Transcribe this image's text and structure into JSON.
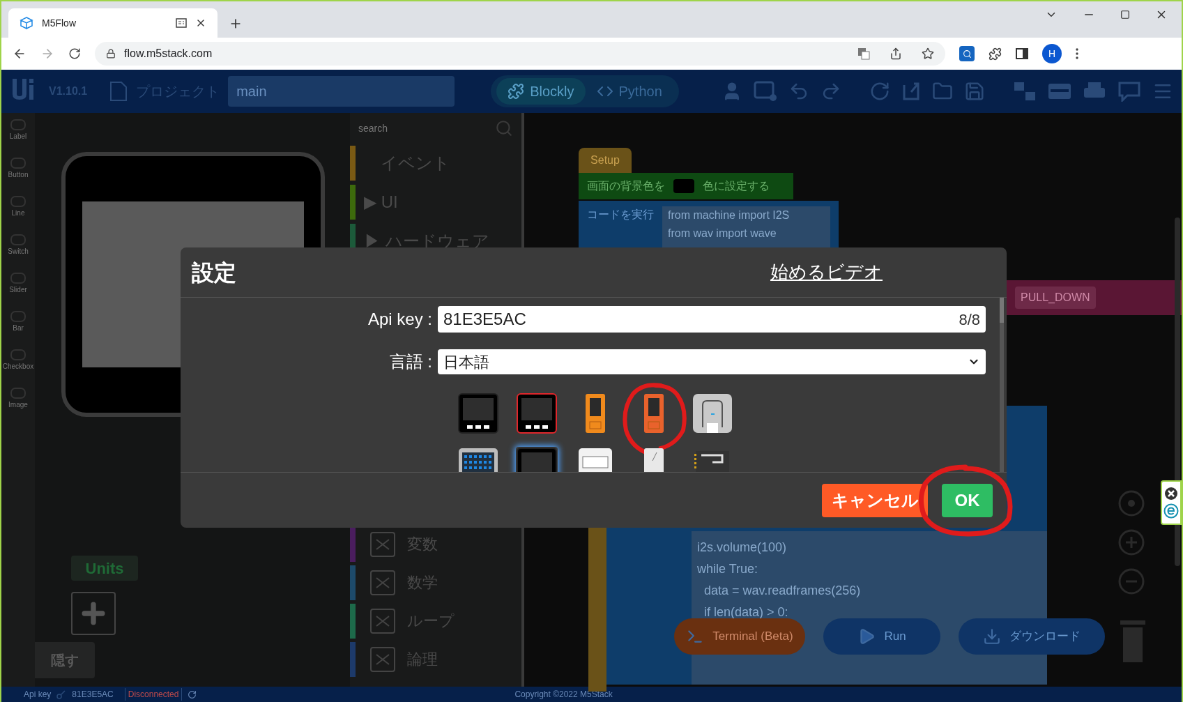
{
  "browser": {
    "tab_title": "M5Flow",
    "url": "flow.m5stack.com",
    "profile_initial": "H"
  },
  "app_header": {
    "version": "V1.10.1",
    "project_label": "プロジェクト",
    "project_name": "main",
    "modes": [
      {
        "label": "Blockly",
        "selected": true
      },
      {
        "label": "Python",
        "selected": false
      }
    ]
  },
  "ui_palette": [
    "Label",
    "Button",
    "Line",
    "Switch",
    "Slider",
    "Bar",
    "Checkbox",
    "Image"
  ],
  "units": {
    "title": "Units"
  },
  "hide_button": "隠す",
  "block_categories": {
    "search_placeholder": "search",
    "top": [
      {
        "label": "イベント",
        "color": "#7a5a14"
      },
      {
        "label": "UI",
        "marker": "▶",
        "color": "#3d6a0c"
      },
      {
        "label": "ハードウェア",
        "marker": "▶",
        "color": "#1c5a3a"
      }
    ],
    "bottom": [
      {
        "label": "変数",
        "color": "#4a1d5e"
      },
      {
        "label": "数学",
        "color": "#1d4a6a"
      },
      {
        "label": "ループ",
        "color": "#1d6a4a"
      },
      {
        "label": "論理",
        "color": "#1d3a6a"
      }
    ]
  },
  "workspace": {
    "setup": "Setup",
    "bg_block": [
      "画面の背景色を",
      "色に設定する"
    ],
    "exec_label": "コードを実行",
    "exec_code": [
      "from machine import I2S",
      "from wav import wave"
    ],
    "pin_option": "PULL_DOWN",
    "code_lines": [
      "i2s.volume(100)",
      "while True:",
      "  data = wav.readframes(256)",
      "  if len(data) > 0:"
    ],
    "actions": [
      {
        "kind": "terminal",
        "label": "Terminal (Beta)"
      },
      {
        "kind": "run",
        "label": "Run"
      },
      {
        "kind": "download",
        "label": "ダウンロード"
      }
    ]
  },
  "status_bar": {
    "api_label": "Api key",
    "api_value": "81E3E5AC",
    "connection": "Disconnected",
    "copyright": "Copyright ©2022 M5Stack"
  },
  "dialog": {
    "title": "設定",
    "video_link": "始めるビデオ",
    "api_key": {
      "label": "Api key :",
      "value": "81E3E5AC",
      "counter": "8/8"
    },
    "language": {
      "label": "言語 :",
      "value": "日本語"
    },
    "devices": [
      {
        "kind": "core-black",
        "selected": false
      },
      {
        "kind": "core-red",
        "selected": false
      },
      {
        "kind": "stick-orange",
        "selected": false
      },
      {
        "kind": "stick-dark-orange",
        "selected": false,
        "annotated": true
      },
      {
        "kind": "atom-gray",
        "selected": false
      },
      {
        "kind": "panel-blue",
        "selected": false
      },
      {
        "kind": "core-black",
        "selected": true
      },
      {
        "kind": "module-white",
        "selected": false
      },
      {
        "kind": "stick-white",
        "selected": false
      },
      {
        "kind": "board",
        "selected": false
      }
    ],
    "buttons": [
      {
        "kind": "cancel",
        "label": "キャンセル"
      },
      {
        "kind": "ok",
        "label": "OK",
        "annotated": true
      }
    ]
  }
}
